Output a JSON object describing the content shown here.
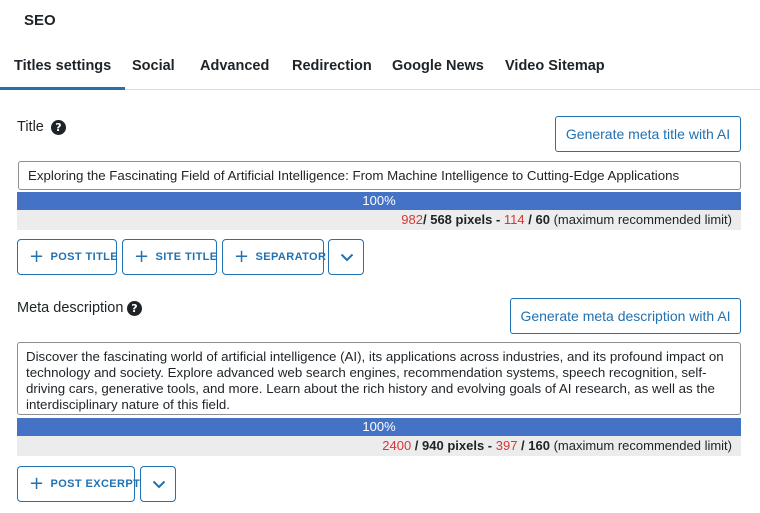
{
  "header": {
    "title": "SEO"
  },
  "tabs": [
    {
      "label": "Titles settings",
      "active": true
    },
    {
      "label": "Social"
    },
    {
      "label": "Advanced"
    },
    {
      "label": "Redirection"
    },
    {
      "label": "Google News"
    },
    {
      "label": "Video Sitemap"
    }
  ],
  "title_section": {
    "label": "Title",
    "help_icon": "?",
    "ai_button": "Generate meta title with AI",
    "value": "Exploring the Fascinating Field of Artificial Intelligence: From Machine Intelligence to Cutting-Edge Applications",
    "progress": {
      "percent": 100,
      "label": "100%"
    },
    "stats": {
      "pixels_used": "982",
      "pixels_max": "/ 568 pixels - ",
      "chars_used": "114",
      "chars_max": " / 60 ",
      "note": "(maximum recommended limit)"
    },
    "tag_buttons": [
      "POST TITLE",
      "SITE TITLE",
      "SEPARATOR"
    ],
    "more_icon": "chevron-down-icon"
  },
  "meta_section": {
    "label": "Meta description",
    "help_icon": "?",
    "ai_button": "Generate meta description with AI",
    "value": "Discover the fascinating world of artificial intelligence (AI), its applications across industries, and its profound impact on technology and society. Explore advanced web search engines, recommendation systems, speech recognition, self-driving cars, generative tools, and more. Learn about the rich history and evolving goals of AI research, as well as the interdisciplinary nature of this field.",
    "progress": {
      "percent": 100,
      "label": "100%"
    },
    "stats": {
      "pixels_used": "2400",
      "pixels_max": " / 940 pixels - ",
      "chars_used": "397",
      "chars_max": " / 160 ",
      "note": "(maximum recommended limit)"
    },
    "tag_buttons": [
      "POST EXCERPT"
    ],
    "more_icon": "chevron-down-icon"
  },
  "colors": {
    "accent": "#2271b1",
    "bar": "#4472c4",
    "over_limit": "#d63638",
    "stats_bg": "#ececec"
  }
}
